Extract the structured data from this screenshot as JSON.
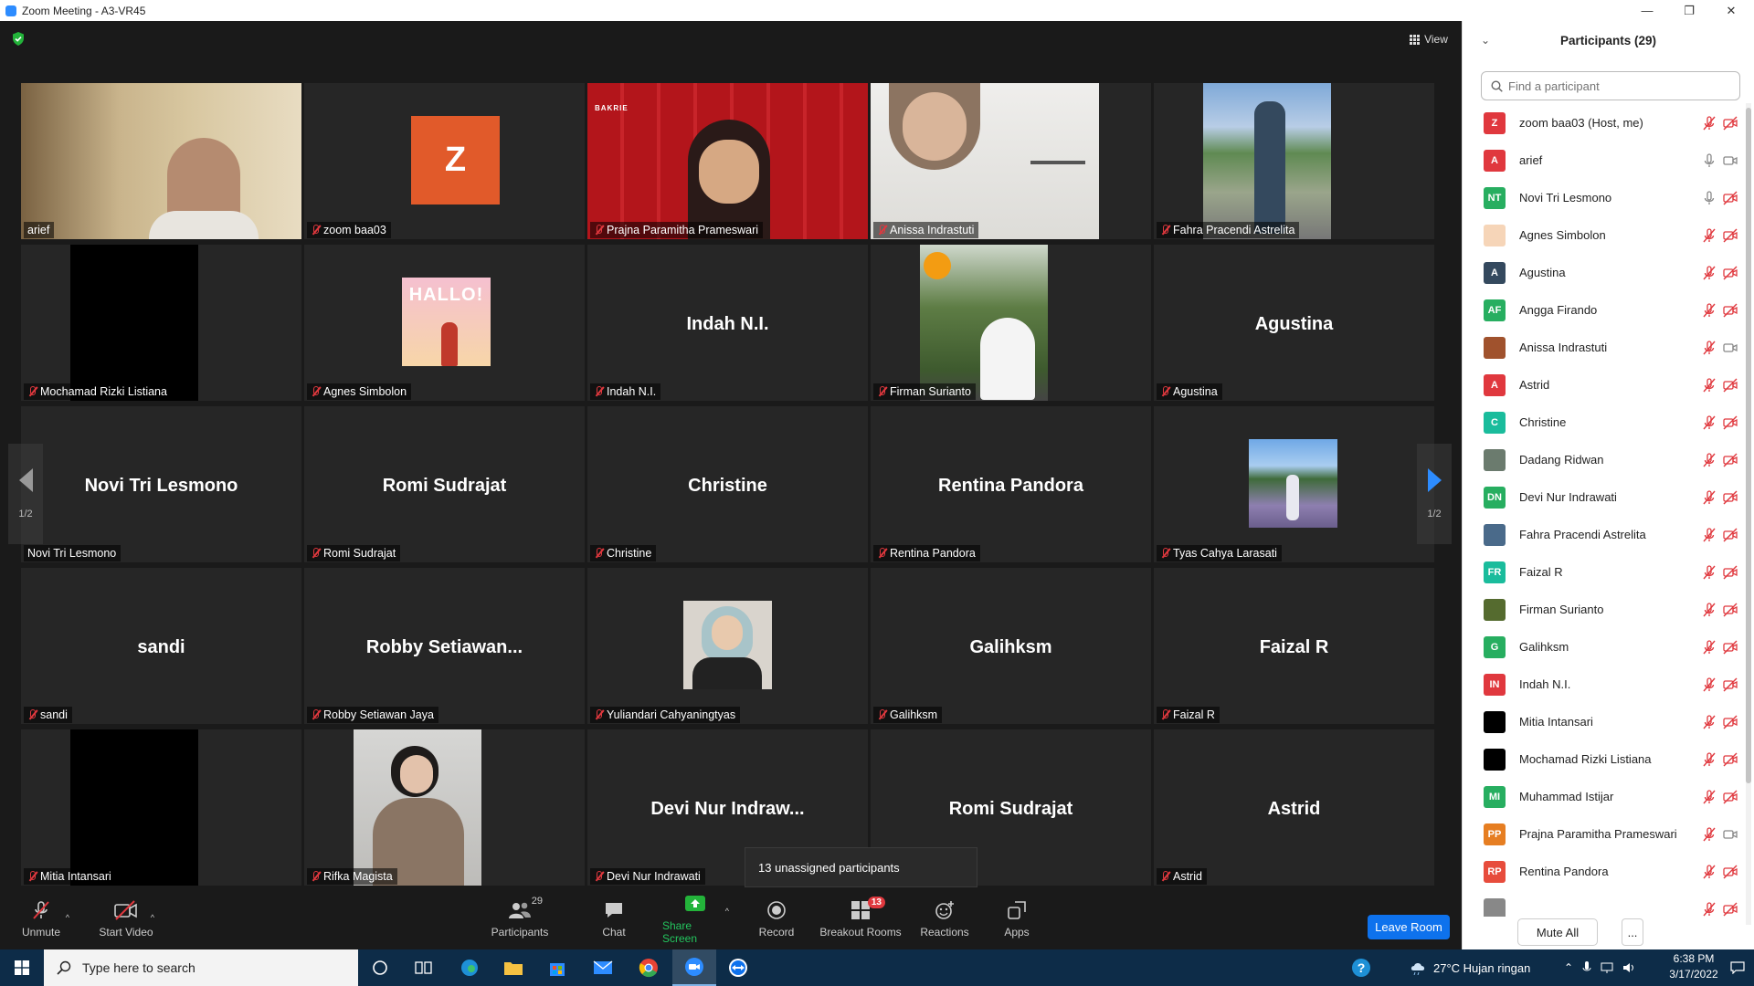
{
  "window": {
    "title": "Zoom Meeting - A3-VR45",
    "min_glyph": "—",
    "max_glyph": "❐",
    "close_glyph": "✕"
  },
  "header": {
    "view_label": "View"
  },
  "pager": {
    "page": "1/2"
  },
  "tiles": [
    {
      "big": "",
      "name": "arief",
      "muted": false
    },
    {
      "big": "",
      "avatar": "Z",
      "name": "zoom baa03",
      "muted": true
    },
    {
      "big": "",
      "name": "Prajna Paramitha Prameswari",
      "muted": true,
      "photo_text": "BAKRIE"
    },
    {
      "big": "",
      "name": "Anissa Indrastuti",
      "muted": true
    },
    {
      "big": "",
      "name": "Fahra Pracendi Astrelita",
      "muted": true
    },
    {
      "big": "",
      "name": "Mochamad Rizki Listiana",
      "muted": true
    },
    {
      "big": "",
      "name": "Agnes Simbolon",
      "muted": true,
      "photo_text": "HALLO!"
    },
    {
      "big": "Indah N.I.",
      "name": "Indah N.I.",
      "muted": true
    },
    {
      "big": "",
      "name": "Firman Surianto",
      "muted": true
    },
    {
      "big": "Agustina",
      "name": "Agustina",
      "muted": true
    },
    {
      "big": "Novi Tri Lesmono",
      "name": "Novi Tri Lesmono",
      "muted": false
    },
    {
      "big": "Romi Sudrajat",
      "name": "Romi Sudrajat",
      "muted": true
    },
    {
      "big": "Christine",
      "name": "Christine",
      "muted": true
    },
    {
      "big": "Rentina Pandora",
      "name": "Rentina Pandora",
      "muted": true
    },
    {
      "big": "",
      "name": "Tyas Cahya Larasati",
      "muted": true
    },
    {
      "big": "sandi",
      "name": "sandi",
      "muted": true
    },
    {
      "big": "Robby  Setiawan...",
      "name": "Robby Setiawan Jaya",
      "muted": true
    },
    {
      "big": "",
      "name": "Yuliandari Cahyaningtyas",
      "muted": true
    },
    {
      "big": "Galihksm",
      "name": "Galihksm",
      "muted": true
    },
    {
      "big": "Faizal R",
      "name": "Faizal R",
      "muted": true
    },
    {
      "big": "",
      "name": "Mitia Intansari",
      "muted": true
    },
    {
      "big": "",
      "name": "Rifka Magista",
      "muted": true
    },
    {
      "big": "Devi Nur Indraw...",
      "name": "Devi Nur Indrawati",
      "muted": true
    },
    {
      "big": "Romi Sudrajat",
      "name": "",
      "muted": false
    },
    {
      "big": "Astrid",
      "name": "Astrid",
      "muted": true
    }
  ],
  "toast": {
    "text": "13 unassigned participants"
  },
  "toolbar": {
    "unmute": "Unmute",
    "start_video": "Start Video",
    "participants": "Participants",
    "participants_count": "29",
    "chat": "Chat",
    "share_screen": "Share Screen",
    "record": "Record",
    "breakout_rooms": "Breakout Rooms",
    "breakout_count": "13",
    "reactions": "Reactions",
    "apps": "Apps",
    "leave_room": "Leave Room"
  },
  "panel": {
    "title": "Participants (29)",
    "search_placeholder": "Find a participant",
    "mute_all": "Mute All",
    "more": "...",
    "participants": [
      {
        "initials": "Z",
        "color": "#e0383e",
        "name": "zoom baa03 (Host, me)",
        "mic": "off",
        "cam": "off"
      },
      {
        "initials": "A",
        "color": "#e0383e",
        "name": "arief",
        "mic": "on",
        "cam": "on"
      },
      {
        "initials": "NT",
        "color": "#27ae60",
        "name": "Novi Tri Lesmono",
        "mic": "on",
        "cam": "off"
      },
      {
        "initials": "",
        "color": "#f6d5b8",
        "name": "Agnes Simbolon",
        "mic": "off",
        "cam": "off"
      },
      {
        "initials": "A",
        "color": "#34495e",
        "name": "Agustina",
        "mic": "off",
        "cam": "off"
      },
      {
        "initials": "AF",
        "color": "#27ae60",
        "name": "Angga Firando",
        "mic": "off",
        "cam": "off"
      },
      {
        "initials": "",
        "color": "#a0522d",
        "name": "Anissa Indrastuti",
        "mic": "off",
        "cam": "on"
      },
      {
        "initials": "A",
        "color": "#e0383e",
        "name": "Astrid",
        "mic": "off",
        "cam": "off"
      },
      {
        "initials": "C",
        "color": "#1abc9c",
        "name": "Christine",
        "mic": "off",
        "cam": "off"
      },
      {
        "initials": "",
        "color": "#6b7b6e",
        "name": "Dadang Ridwan",
        "mic": "off",
        "cam": "off"
      },
      {
        "initials": "DN",
        "color": "#27ae60",
        "name": "Devi Nur Indrawati",
        "mic": "off",
        "cam": "off"
      },
      {
        "initials": "",
        "color": "#4a6a8a",
        "name": "Fahra Pracendi Astrelita",
        "mic": "off",
        "cam": "off"
      },
      {
        "initials": "FR",
        "color": "#1abc9c",
        "name": "Faizal R",
        "mic": "off",
        "cam": "off"
      },
      {
        "initials": "",
        "color": "#556b2f",
        "name": "Firman Surianto",
        "mic": "off",
        "cam": "off"
      },
      {
        "initials": "G",
        "color": "#27ae60",
        "name": "Galihksm",
        "mic": "off",
        "cam": "off"
      },
      {
        "initials": "IN",
        "color": "#e0383e",
        "name": "Indah N.I.",
        "mic": "off",
        "cam": "off"
      },
      {
        "initials": "",
        "color": "#000000",
        "name": "Mitia Intansari",
        "mic": "off",
        "cam": "off"
      },
      {
        "initials": "",
        "color": "#000000",
        "name": "Mochamad Rizki Listiana",
        "mic": "off",
        "cam": "off"
      },
      {
        "initials": "MI",
        "color": "#27ae60",
        "name": "Muhammad Istijar",
        "mic": "off",
        "cam": "off"
      },
      {
        "initials": "PP",
        "color": "#e67e22",
        "name": "Prajna Paramitha Prameswari",
        "mic": "off",
        "cam": "on"
      },
      {
        "initials": "RP",
        "color": "#e74c3c",
        "name": "Rentina Pandora",
        "mic": "off",
        "cam": "off"
      },
      {
        "initials": "",
        "color": "#888888",
        "name": "",
        "mic": "off",
        "cam": "off"
      }
    ]
  },
  "taskbar": {
    "search_placeholder": "Type here to search",
    "weather": "27°C  Hujan ringan",
    "time": "6:38 PM",
    "date": "3/17/2022"
  }
}
